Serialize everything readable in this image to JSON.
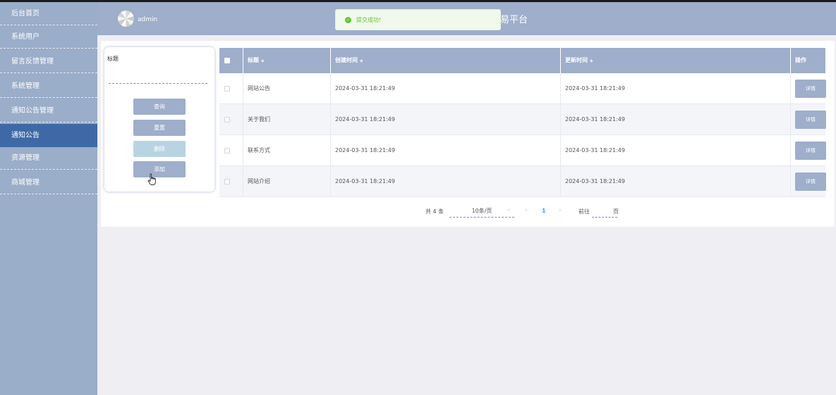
{
  "sidebar": {
    "items": [
      {
        "label": "后台首页",
        "active": false
      },
      {
        "label": "系统用户",
        "active": false
      },
      {
        "label": "留言反馈管理",
        "active": false
      },
      {
        "label": "系统管理",
        "active": false
      },
      {
        "label": "通知公告管理",
        "active": false
      },
      {
        "label": "通知公告",
        "active": true
      },
      {
        "label": "资源管理",
        "active": false
      },
      {
        "label": "商城管理",
        "active": false
      }
    ]
  },
  "header": {
    "username": "admin",
    "title_visible": "易平台"
  },
  "toast": {
    "type": "success",
    "icon": "check-circle-icon",
    "message": "提交成功!"
  },
  "search": {
    "label": "标题",
    "value": "",
    "buttons": {
      "query": "查询",
      "reset": "重置",
      "delete": "删除",
      "add": "添加"
    }
  },
  "table": {
    "columns": [
      "标题",
      "创建时间",
      "更新时间",
      "操作"
    ],
    "detail_label": "详情",
    "rows": [
      {
        "title": "网站公告",
        "created": "2024-03-31 18:21:49",
        "updated": "2024-03-31 18:21:49"
      },
      {
        "title": "关于我们",
        "created": "2024-03-31 18:21:49",
        "updated": "2024-03-31 18:21:49"
      },
      {
        "title": "联系方式",
        "created": "2024-03-31 18:21:49",
        "updated": "2024-03-31 18:21:49"
      },
      {
        "title": "网站介绍",
        "created": "2024-03-31 18:21:49",
        "updated": "2024-03-31 18:21:49"
      }
    ]
  },
  "pagination": {
    "total": "共 4 条",
    "page_size": "10条/页",
    "current_page": "1",
    "goto_label": "前往",
    "page_unit": "页"
  },
  "colors": {
    "sidebar_bg": "#9aadc9",
    "sidebar_active": "#3e69a6",
    "header_bg": "#9eaecb",
    "button_bg": "#9eaecb",
    "success": "#67c23a",
    "page_active": "#409eff"
  }
}
